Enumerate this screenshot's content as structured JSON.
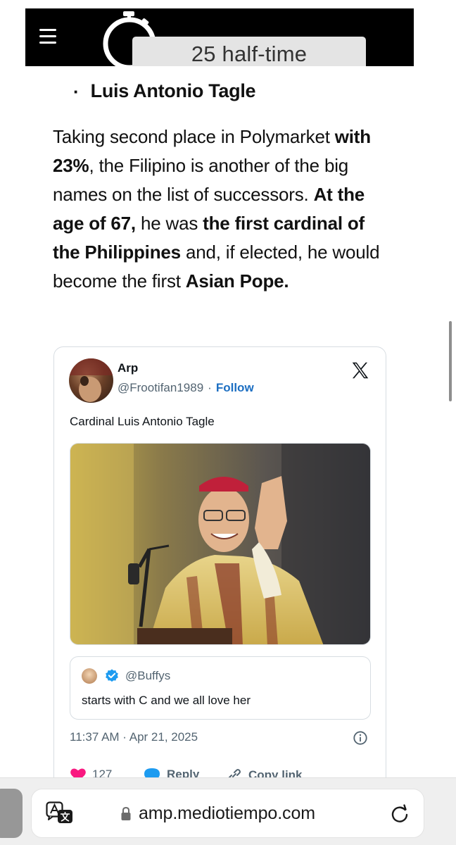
{
  "header": {
    "logo_text": "25 half-time",
    "menu_icon": "hamburger-menu-icon",
    "logo_icon": "stopwatch-icon"
  },
  "article": {
    "bullet": "Luis Antonio Tagle",
    "paragraph": {
      "p1": "Taking second place in Polymarket ",
      "b1": "with 23%",
      "p2": ", the Filipino is another of the big names on the list of successors. ",
      "b2": "At the age of 67,",
      "p3": " he was ",
      "b3": "the first cardinal of the Philippines",
      "p4": " and, if elected, he would become the first ",
      "b4": "Asian Pope."
    }
  },
  "tweet": {
    "author_name": "Arp",
    "handle": "@Frootifan1989",
    "separator": "·",
    "follow_label": "Follow",
    "text": "Cardinal Luis Antonio Tagle",
    "quote": {
      "handle": "@Buffys",
      "text": "starts with C and we all love her"
    },
    "timestamp": "11:37 AM · Apr 21, 2025",
    "actions": {
      "like_count": "127",
      "reply_label": "Reply",
      "copy_label": "Copy link"
    },
    "accent_color": "#1d6fc2",
    "like_color": "#f91880"
  },
  "browser": {
    "url": "amp.mediotiempo.com"
  }
}
